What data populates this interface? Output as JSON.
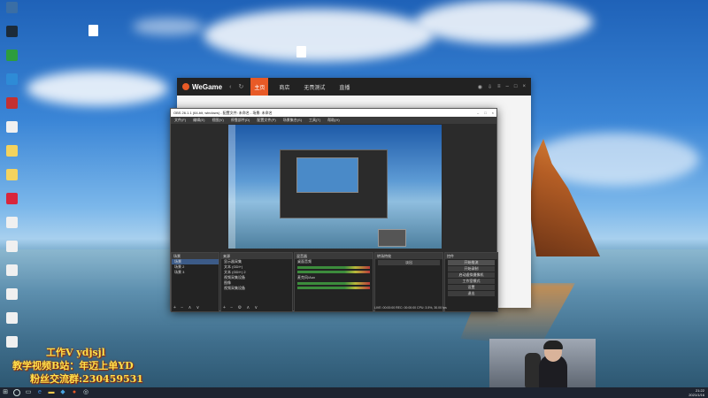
{
  "desktop": {
    "icons": [
      {
        "label": "",
        "color": "#3a6ea5"
      },
      {
        "label": "",
        "color": "#1c2b3a"
      },
      {
        "label": "",
        "color": "#2d9d3d"
      },
      {
        "label": "",
        "color": "#2e8bd6"
      },
      {
        "label": "",
        "color": "#c43131"
      },
      {
        "label": "",
        "color": "#f0f0f0"
      },
      {
        "label": "",
        "color": "#f4d35e"
      },
      {
        "label": "",
        "color": "#f4d35e"
      },
      {
        "label": "",
        "color": "#d9263c"
      },
      {
        "label": "",
        "color": "#f0f0f0"
      },
      {
        "label": "",
        "color": "#f0f0f0"
      },
      {
        "label": "",
        "color": "#f0f0f0"
      },
      {
        "label": "",
        "color": "#f0f0f0"
      },
      {
        "label": "",
        "color": "#f0f0f0"
      },
      {
        "label": "",
        "color": "#f0f0f0"
      }
    ]
  },
  "wegame": {
    "logo": "WeGame",
    "tabs": [
      "主页",
      "商店",
      "无畏测试",
      "直播"
    ],
    "active_tab": 0
  },
  "obs": {
    "title": "OBS 26.1.1 (64-bit, windows) - 配置文件: 未命名 - 场景: 未命名",
    "menu": [
      "文件(F)",
      "编辑(E)",
      "视图(V)",
      "停靠部件(D)",
      "配置文件(P)",
      "场景集合(S)",
      "工具(T)",
      "帮助(H)"
    ],
    "docks": {
      "scenes_title": "场景",
      "scenes": [
        "场景",
        "场景 2",
        "场景 3"
      ],
      "sources_title": "来源",
      "sources": [
        "显示器采集",
        "文本 (GDI+)",
        "文本 (GDI+) 2",
        "视频采集设备",
        "图像",
        "视频采集设备"
      ],
      "mixer_title": "混音器",
      "mixer": [
        "桌面音频",
        "麦克风/Aux"
      ],
      "transitions_title": "转场特效",
      "transition_value": "淡出",
      "controls_title": "控件",
      "controls": [
        "开始推流",
        "开始录制",
        "启动虚拟摄像机",
        "工作室模式",
        "设置",
        "退出"
      ]
    },
    "status": "LIVE: 00:00:00   REC: 00:00:00   CPU: 3.5%, 30.00 fps"
  },
  "watermark": {
    "line1": "工作V ydjsjl",
    "line2": "教学视频B站：年迈上单YD",
    "line3": "粉丝交流群:230459531"
  },
  "taskbar": {
    "time": "21:22",
    "date": "2021/1/16"
  }
}
